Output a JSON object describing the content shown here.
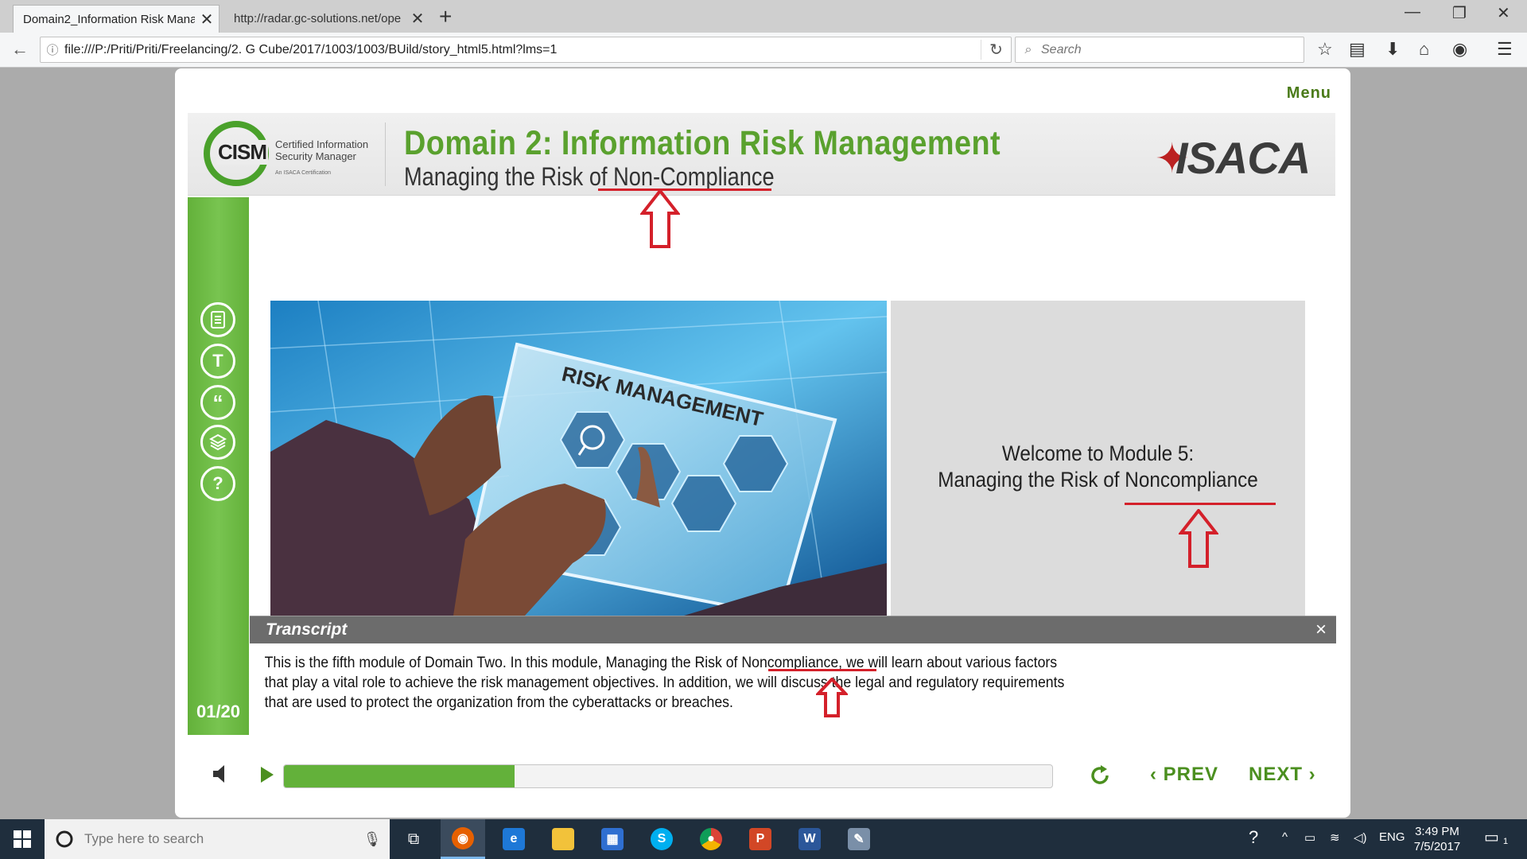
{
  "browser": {
    "tabs": [
      {
        "title": "Domain2_Information Risk Mana",
        "active": true
      },
      {
        "title": "http://radar.gc-solutions.net/ope",
        "active": false
      }
    ],
    "url": "file:///P:/Priti/Priti/Freelancing/2. G Cube/2017/1003/1003/BUild/story_html5.html?lms=1",
    "search_placeholder": "Search"
  },
  "course": {
    "menu_label": "Menu",
    "logo_left": {
      "acronym": "CISM",
      "line1": "Certified Information",
      "line2": "Security Manager",
      "tagline": "An ISACA Certification"
    },
    "logo_right": "ISACA",
    "title": "Domain 2: Information Risk Management",
    "subtitle": "Managing the Risk of Non-Compliance",
    "image_label": "RISK MANAGEMENT",
    "welcome_line1": "Welcome to Module 5:",
    "welcome_line2": "Managing the Risk of Noncompliance",
    "page_counter": "01/20",
    "transcript": {
      "title": "Transcript",
      "close_glyph": "×",
      "body": "This is the fifth module of Domain Two. In this module, Managing the Risk of Noncompliance, we will learn about various factors that play a vital role to achieve the risk management objectives. In addition, we will discuss the legal and regulatory requirements that are used to protect the organization from the cyberattacks or breaches."
    },
    "progress_fraction": 0.3,
    "prev_label": "PREV",
    "next_label": "NEXT",
    "colors": {
      "accent": "#63b13a",
      "nav_text": "#4b8f1f",
      "annotation": "#d4202a"
    }
  },
  "taskbar": {
    "search_placeholder": "Type here to search",
    "language": "ENG",
    "time": "3:49 PM",
    "date": "7/5/2017",
    "notification_count": "1"
  }
}
